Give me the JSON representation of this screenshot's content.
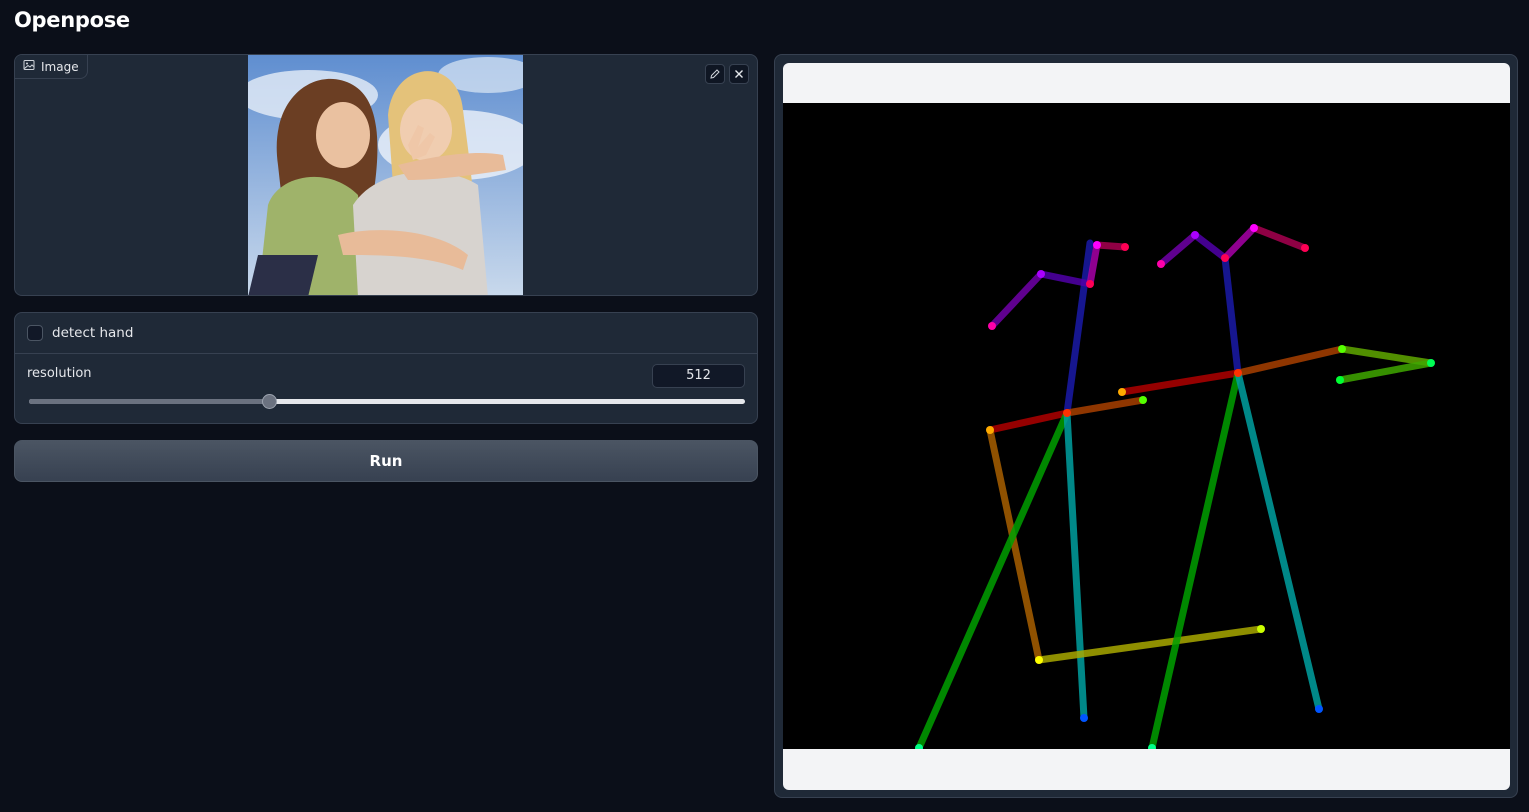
{
  "app": {
    "title": "Openpose"
  },
  "input_image": {
    "label": "Image",
    "icon": "image-icon",
    "edit_icon": "pencil-icon",
    "clear_icon": "close-icon"
  },
  "controls": {
    "detect_hand": {
      "label": "detect hand",
      "checked": false
    },
    "resolution": {
      "label": "resolution",
      "value": "512",
      "slider_fraction": 0.335
    }
  },
  "run_button": {
    "label": "Run"
  },
  "colors": {
    "background": "#0b0f19",
    "panel": "#1f2937",
    "border": "#374151",
    "canvas": "#000000"
  }
}
